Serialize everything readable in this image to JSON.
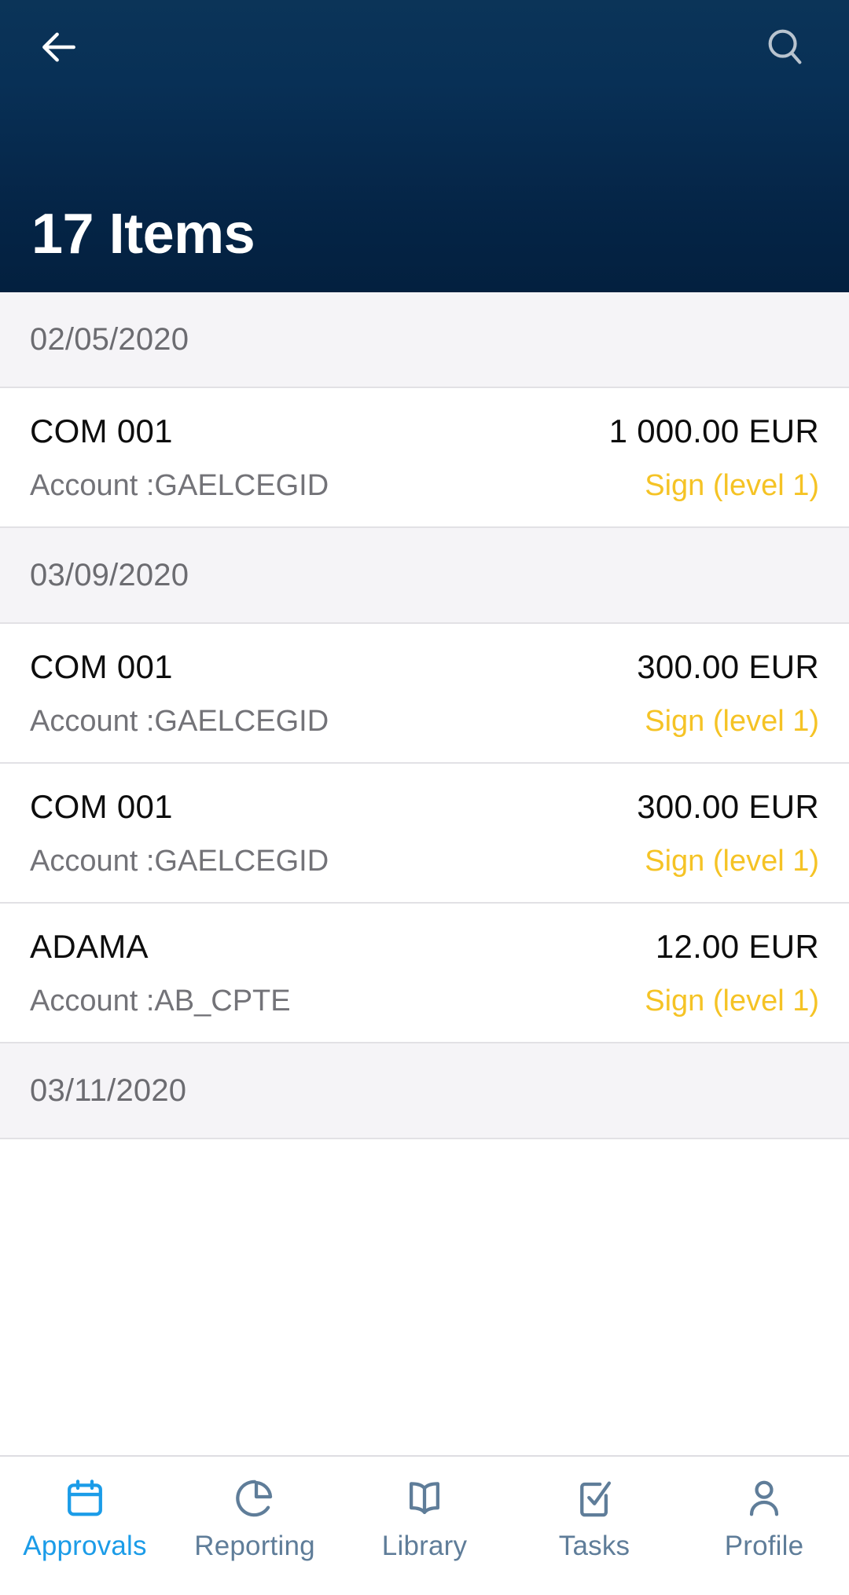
{
  "header": {
    "back_icon": "arrow-left-icon",
    "search_icon": "search-icon",
    "title": "17 Items",
    "gradient_top": "#0b3458",
    "gradient_bottom": "#03203f"
  },
  "colors": {
    "status_amber": "#f5c325",
    "nav_active": "#1b9ce8",
    "nav_inactive": "#5f7d99",
    "section_bg": "#f5f4f7",
    "divider": "#e2e1e5"
  },
  "list": {
    "sections": [
      {
        "date": "02/05/2020",
        "items": [
          {
            "title": "COM 001",
            "amount": "1 000.00 EUR",
            "account": "Account :GAELCEGID",
            "status": "Sign (level 1)"
          }
        ]
      },
      {
        "date": "03/09/2020",
        "items": [
          {
            "title": "COM 001",
            "amount": "300.00 EUR",
            "account": "Account :GAELCEGID",
            "status": "Sign (level 1)"
          },
          {
            "title": "COM 001",
            "amount": "300.00 EUR",
            "account": "Account :GAELCEGID",
            "status": "Sign (level 1)"
          },
          {
            "title": "ADAMA",
            "amount": "12.00 EUR",
            "account": "Account :AB_CPTE",
            "status": "Sign (level 1)"
          }
        ]
      },
      {
        "date": "03/11/2020",
        "items": []
      }
    ]
  },
  "bottom_nav": {
    "items": [
      {
        "label": "Approvals",
        "icon": "calendar-icon",
        "active": true
      },
      {
        "label": "Reporting",
        "icon": "pie-chart-icon",
        "active": false
      },
      {
        "label": "Library",
        "icon": "book-icon",
        "active": false
      },
      {
        "label": "Tasks",
        "icon": "checklist-icon",
        "active": false
      },
      {
        "label": "Profile",
        "icon": "person-icon",
        "active": false
      }
    ]
  }
}
